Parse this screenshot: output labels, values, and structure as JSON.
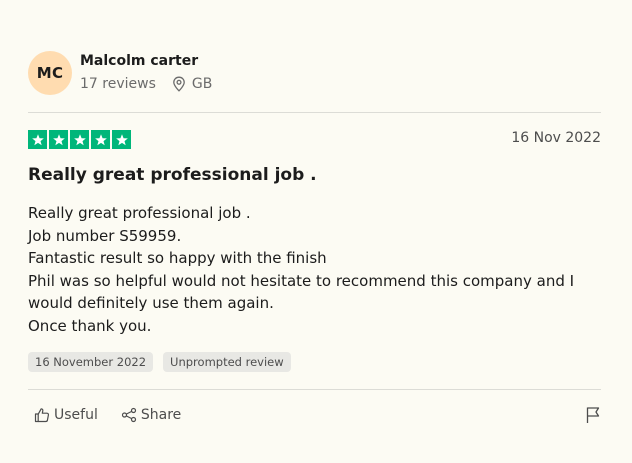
{
  "reviewer": {
    "initials": "MC",
    "name": "Malcolm carter",
    "reviews": "17 reviews",
    "country": "GB",
    "avatar_color": "#ffdcb0"
  },
  "review": {
    "rating": 5,
    "star_color": "#00b67a",
    "date": "16 Nov 2022",
    "title": "Really great professional job .",
    "body_lines": [
      "Really great professional job .",
      "Job number S59959.",
      "Fantastic result so happy with the finish",
      "Phil was so helpful would not hesitate to recommend this company and I",
      "would definitely use them again.",
      "Once thank you."
    ],
    "tags": [
      "16 November 2022",
      "Unprompted review"
    ]
  },
  "actions": {
    "useful_label": "Useful",
    "share_label": "Share",
    "icons": [
      "thumbs-up-icon",
      "share-icon",
      "flag-icon"
    ]
  }
}
